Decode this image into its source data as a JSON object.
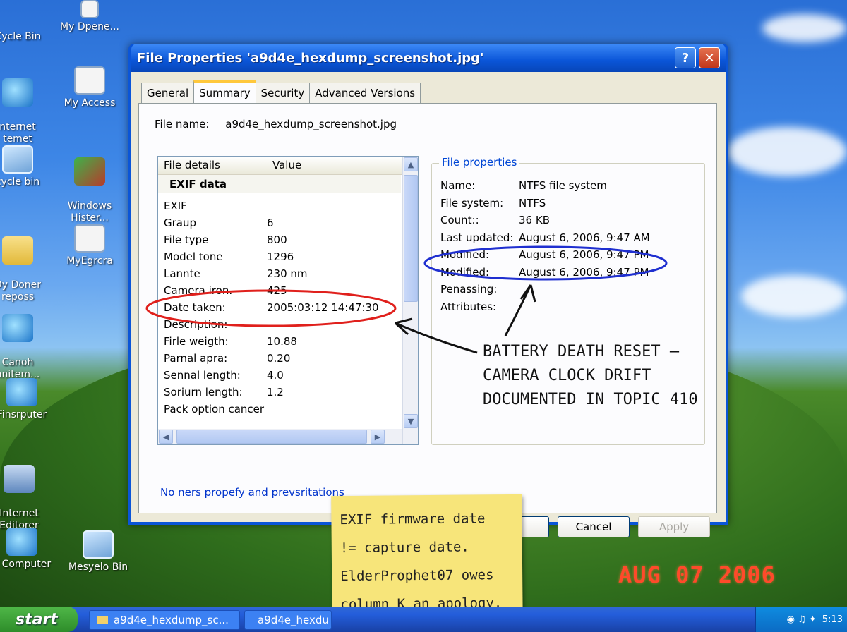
{
  "desktop": {
    "icons": [
      {
        "label": "Cycle Bin"
      },
      {
        "label": "My Dpene..."
      },
      {
        "label": "nternet\ntemet"
      },
      {
        "label": "My Access"
      },
      {
        "label": "cycle bin"
      },
      {
        "label": "Windows\nHister..."
      },
      {
        "label": "Dy Doner\nreposs"
      },
      {
        "label": "MyEgrcra"
      },
      {
        "label": "Canoh\nnnitem..."
      },
      {
        "label": "Finsrputer"
      },
      {
        "label": "Internet\nEditorer"
      },
      {
        "label": "y Computer"
      },
      {
        "label": "Mesyelo Bin"
      }
    ]
  },
  "dialog": {
    "title": "File Properties 'a9d4e_hexdump_screenshot.jpg'",
    "help_label": "?",
    "close_label": "✕",
    "tabs": [
      {
        "label": "General"
      },
      {
        "label": "Summary"
      },
      {
        "label": "Security"
      },
      {
        "label": "Advanced Versions"
      }
    ],
    "file_name_label": "File name:",
    "file_name_value": "a9d4e_hexdump_screenshot.jpg",
    "details": {
      "col_name": "File details",
      "col_value": "Value",
      "group": "EXIF data",
      "rows": [
        {
          "k": "EXIF",
          "v": ""
        },
        {
          "k": "Graup",
          "v": "6"
        },
        {
          "k": "File type",
          "v": "800"
        },
        {
          "k": "Model tone",
          "v": "1296"
        },
        {
          "k": "Lannte",
          "v": "230 nm"
        },
        {
          "k": "Camera iron.",
          "v": "425"
        },
        {
          "k": "Date taken:",
          "v": "2005:03:12 14:47:30"
        },
        {
          "k": "Description:",
          "v": ""
        },
        {
          "k": "Firle weigth:",
          "v": "10.88"
        },
        {
          "k": "Parnal apra:",
          "v": "0.20"
        },
        {
          "k": "Sennal length:",
          "v": "4.0"
        },
        {
          "k": "Soriurn length:",
          "v": "1.2"
        },
        {
          "k": "Pack option cancer",
          "v": ""
        }
      ]
    },
    "file_properties": {
      "legend": "File properties",
      "rows": [
        {
          "k": "Name:",
          "v": "NTFS file system"
        },
        {
          "k": "File system:",
          "v": "NTFS"
        },
        {
          "k": "Count::",
          "v": "36 KB"
        },
        {
          "k": "Last updated:",
          "v": "August 6, 2006, 9:47 AM"
        },
        {
          "k": "Modified:",
          "v": "August 6, 2006, 9:47 PM"
        },
        {
          "k": "Modified:",
          "v": "August 6, 2006, 9:47 PM"
        },
        {
          "k": "Penassing:",
          "v": ""
        },
        {
          "k": "Attributes:",
          "v": ""
        }
      ]
    },
    "link_text": "No ners propefy and prevsritations",
    "buttons": {
      "ok": "",
      "cancel": "Cancel",
      "apply": "Apply"
    }
  },
  "annotations": {
    "handwritten": [
      "BATTERY DEATH RESET –",
      "CAMERA CLOCK DRIFT",
      "DOCUMENTED IN TOPIC 410"
    ],
    "sticky_note": [
      "EXIF firmware date",
      "!= capture date.",
      "ElderProphet07 owes",
      "column K an apology."
    ],
    "camera_datestamp": "AUG 07 2006",
    "circle_colors": {
      "red": "#e0201c",
      "blue": "#1f2fd0"
    }
  },
  "taskbar": {
    "start_label": "start",
    "tasks": [
      {
        "label": "a9d4e_hexdump_sc..."
      },
      {
        "label": "a9d4e_hexdu"
      }
    ],
    "clock": "5:13"
  }
}
